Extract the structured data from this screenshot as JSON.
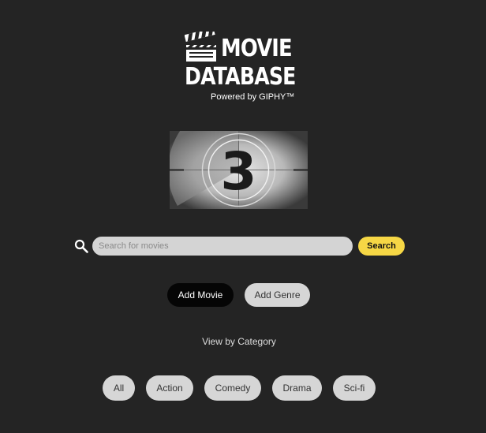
{
  "logo": {
    "line1": "MOVIE",
    "line2": "DATABASE",
    "powered_by": "Powered by GIPHY™",
    "icon": "clapperboard-icon"
  },
  "countdown": {
    "number": "3"
  },
  "search": {
    "placeholder": "Search for movies",
    "value": "",
    "button_label": "Search",
    "icon": "search-icon"
  },
  "actions": {
    "add_movie": "Add Movie",
    "add_genre": "Add Genre"
  },
  "category": {
    "label": "View by Category",
    "items": [
      "All",
      "Action",
      "Comedy",
      "Drama",
      "Sci-fi"
    ]
  },
  "colors": {
    "background": "#242424",
    "accent": "#f6d745",
    "pill_light": "#d6d6d6",
    "pill_dark": "#050505"
  }
}
